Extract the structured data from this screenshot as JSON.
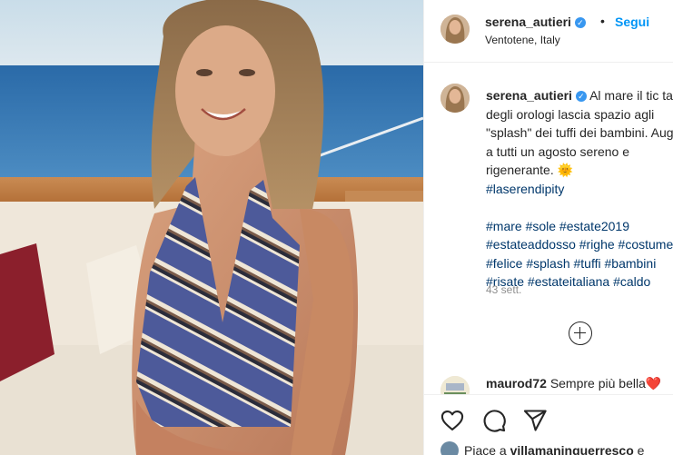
{
  "post": {
    "author": "serena_autieri",
    "verified": true,
    "follow_label": "Segui",
    "separator": "•",
    "location": "Ventotene, Italy"
  },
  "caption": {
    "author": "serena_autieri",
    "lines": [
      "Al mare il tic tac",
      "degli orologi lascia spazio agli",
      "\"splash\" dei tuffi dei bambini. Auguro",
      "a tutti un agosto sereno e",
      "rigenerante. 🌞",
      "#laserendipity",
      "",
      "#mare #sole #estate2019",
      "#estateaddosso #righe #costume",
      "#felice #splash #tuffi #bambini",
      "#risate #estateitaliana #caldo"
    ],
    "time": "43 sett."
  },
  "comment": {
    "author": "maurod72",
    "text": "Sempre più bella",
    "emoji": "❤️"
  },
  "actions": {
    "like_icon": "heart-icon",
    "comment_icon": "comment-icon",
    "share_icon": "share-icon"
  },
  "likes": {
    "prefix": "Piace a",
    "user": "villamaninguerresco",
    "suffix": "e"
  },
  "colors": {
    "link_blue": "#0095f6",
    "hashtag": "#00376b",
    "verified": "#3897f0",
    "muted": "#8e8e8e"
  }
}
